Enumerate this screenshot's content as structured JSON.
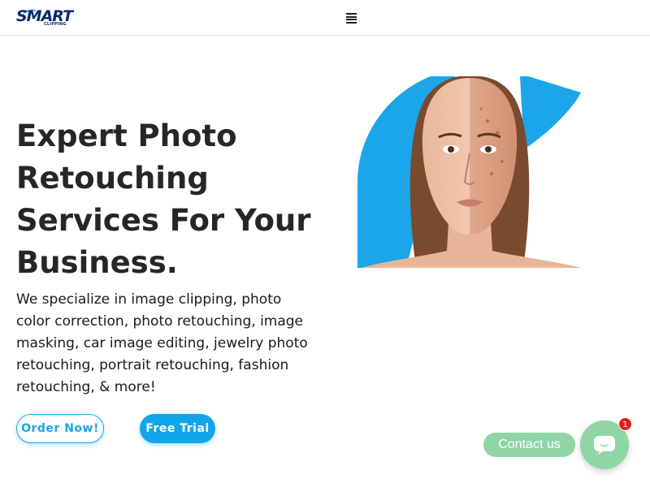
{
  "brand": {
    "logo_text": "SMART",
    "logo_subtext": "CLIPPING"
  },
  "header": {
    "menu_icon": "hamburger-menu-icon"
  },
  "hero": {
    "title": "Expert Photo Retouching Services For Your Business.",
    "description": "We specialize in image clipping, photo color correction, photo retouching, image masking, car image editing, jewelry photo retouching, portrait retouching, fashion retouching, & more!",
    "order_button": "Order Now!",
    "trial_button": "Free Trial",
    "image_alt_icon": "before-after-face-retouch-image"
  },
  "chat": {
    "label": "Contact us",
    "badge_count": "1",
    "icon": "chat-bubble-icon"
  },
  "colors": {
    "accent": "#12a5ec",
    "chat_green": "#8fd5a6",
    "badge_red": "#e02020",
    "logo_navy": "#0d2a6b"
  }
}
